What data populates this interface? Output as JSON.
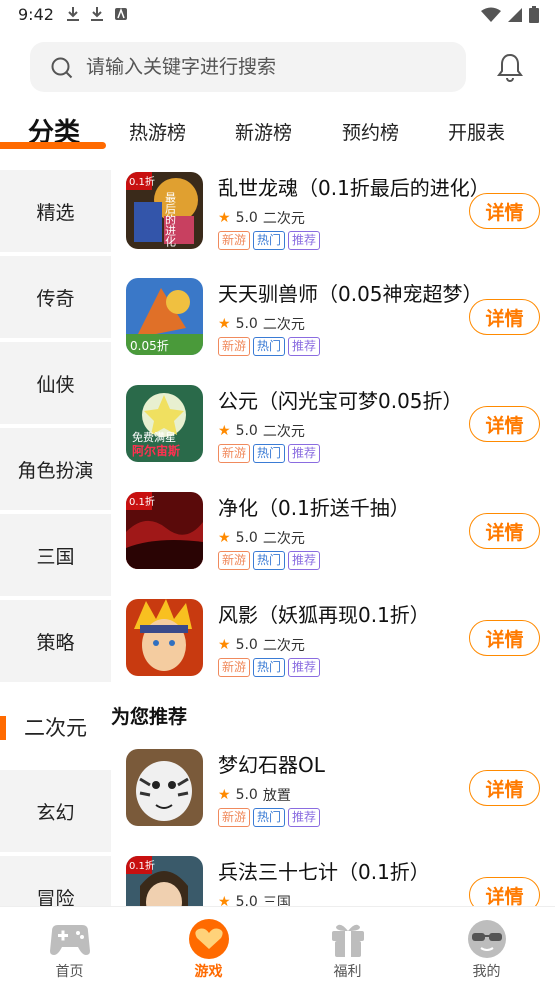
{
  "status": {
    "time": "9:42"
  },
  "search": {
    "placeholder": "请输入关键字进行搜索"
  },
  "tabs": [
    {
      "label": "分类",
      "active": true
    },
    {
      "label": "热游榜",
      "active": false
    },
    {
      "label": "新游榜",
      "active": false
    },
    {
      "label": "预约榜",
      "active": false
    },
    {
      "label": "开服表",
      "active": false
    }
  ],
  "categories": [
    {
      "label": "精选",
      "active": false
    },
    {
      "label": "传奇",
      "active": false
    },
    {
      "label": "仙侠",
      "active": false
    },
    {
      "label": "角色扮演",
      "active": false
    },
    {
      "label": "三国",
      "active": false
    },
    {
      "label": "策略",
      "active": false
    },
    {
      "label": "二次元",
      "active": true
    },
    {
      "label": "玄幻",
      "active": false
    },
    {
      "label": "冒险",
      "active": false
    }
  ],
  "games": [
    {
      "title": "乱世龙魂（0.1折最后的进化）",
      "rating": "5.0",
      "genre": "二次元",
      "tags": [
        "新游",
        "热门",
        "推荐"
      ],
      "detail_label": "详情",
      "icon": "game-icon-luanshi"
    },
    {
      "title": "天天驯兽师（0.05神宠超梦）",
      "rating": "5.0",
      "genre": "二次元",
      "tags": [
        "新游",
        "热门",
        "推荐"
      ],
      "detail_label": "详情",
      "icon": "game-icon-tiantian"
    },
    {
      "title": "公元（闪光宝可梦0.05折）",
      "rating": "5.0",
      "genre": "二次元",
      "tags": [
        "新游",
        "热门",
        "推荐"
      ],
      "detail_label": "详情",
      "icon": "game-icon-gongyuan"
    },
    {
      "title": "净化（0.1折送千抽）",
      "rating": "5.0",
      "genre": "二次元",
      "tags": [
        "新游",
        "热门",
        "推荐"
      ],
      "detail_label": "详情",
      "icon": "game-icon-jinghua"
    },
    {
      "title": "风影（妖狐再现0.1折）",
      "rating": "5.0",
      "genre": "二次元",
      "tags": [
        "新游",
        "热门",
        "推荐"
      ],
      "detail_label": "详情",
      "icon": "game-icon-fengying"
    }
  ],
  "recommend": {
    "title": "为您推荐",
    "games": [
      {
        "title": "梦幻石器OL",
        "rating": "5.0",
        "genre": "放置",
        "tags": [
          "新游",
          "热门",
          "推荐"
        ],
        "detail_label": "详情",
        "icon": "game-icon-menghuan"
      },
      {
        "title": "兵法三十七计（0.1折）",
        "rating": "5.0",
        "genre": "三国",
        "tags": [],
        "detail_label": "详情",
        "icon": "game-icon-bingfa"
      }
    ]
  },
  "icon_texts": {
    "luanshi": [
      "0.1折",
      "最后的进化"
    ],
    "tiantian": [
      "0.05折"
    ],
    "gongyuan": [
      "免费满星",
      "阿尔宙斯"
    ],
    "jinghua": [
      "0.1折"
    ],
    "bingfa": [
      "0.1折"
    ]
  },
  "bottom_nav": [
    {
      "label": "首页",
      "icon": "gamepad-icon",
      "active": false
    },
    {
      "label": "游戏",
      "icon": "heart-game-icon",
      "active": true
    },
    {
      "label": "福利",
      "icon": "gift-icon",
      "active": false
    },
    {
      "label": "我的",
      "icon": "sunglasses-face-icon",
      "active": false
    }
  ],
  "colors": {
    "accent": "#ff6a00",
    "tag_new": "#f08a5d",
    "tag_hot": "#3a7bd5",
    "tag_rec": "#8a6ce0"
  }
}
